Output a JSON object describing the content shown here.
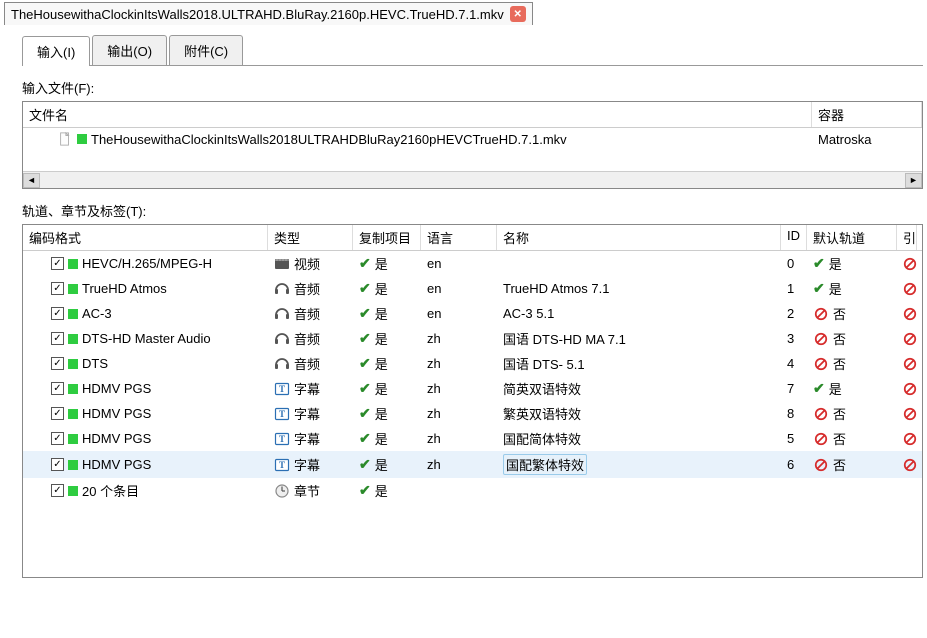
{
  "fileTab": {
    "label": "TheHousewithaClockinItsWalls2018.ULTRAHD.BluRay.2160p.HEVC.TrueHD.7.1.mkv"
  },
  "mainTabs": {
    "input": "输入(I)",
    "output": "输出(O)",
    "attachments": "附件(C)"
  },
  "labels": {
    "inputFiles": "输入文件(F):",
    "tracksChapters": "轨道、章节及标签(T):"
  },
  "filesHeader": {
    "name": "文件名",
    "container": "容器"
  },
  "files": [
    {
      "name": "TheHousewithaClockinItsWalls2018ULTRAHDBluRay2160pHEVCTrueHD.7.1.mkv",
      "container": "Matroska"
    }
  ],
  "tracksHeader": {
    "codec": "编码格式",
    "type": "类型",
    "copy": "复制项目",
    "lang": "语言",
    "name": "名称",
    "id": "ID",
    "default": "默认轨道",
    "last": "引"
  },
  "typeLabels": {
    "video": "视频",
    "audio": "音频",
    "subtitle": "字幕",
    "chapter": "章节"
  },
  "yesNo": {
    "yes": "是",
    "no": "否"
  },
  "tracks": [
    {
      "codec": "HEVC/H.265/MPEG-H",
      "type": "video",
      "copy": true,
      "lang": "en",
      "name": "",
      "id": "0",
      "def": "yes",
      "selected": false
    },
    {
      "codec": "TrueHD Atmos",
      "type": "audio",
      "copy": true,
      "lang": "en",
      "name": "TrueHD Atmos 7.1",
      "id": "1",
      "def": "yes",
      "selected": false
    },
    {
      "codec": "AC-3",
      "type": "audio",
      "copy": true,
      "lang": "en",
      "name": "AC-3 5.1",
      "id": "2",
      "def": "no",
      "selected": false
    },
    {
      "codec": "DTS-HD Master Audio",
      "type": "audio",
      "copy": true,
      "lang": "zh",
      "name": "国语 DTS-HD MA 7.1",
      "id": "3",
      "def": "no",
      "selected": false
    },
    {
      "codec": "DTS",
      "type": "audio",
      "copy": true,
      "lang": "zh",
      "name": "国语 DTS- 5.1",
      "id": "4",
      "def": "no",
      "selected": false
    },
    {
      "codec": "HDMV PGS",
      "type": "subtitle",
      "copy": true,
      "lang": "zh",
      "name": "简英双语特效",
      "id": "7",
      "def": "yes",
      "selected": false
    },
    {
      "codec": "HDMV PGS",
      "type": "subtitle",
      "copy": true,
      "lang": "zh",
      "name": "繁英双语特效",
      "id": "8",
      "def": "no",
      "selected": false
    },
    {
      "codec": "HDMV PGS",
      "type": "subtitle",
      "copy": true,
      "lang": "zh",
      "name": "国配简体特效",
      "id": "5",
      "def": "no",
      "selected": false
    },
    {
      "codec": "HDMV PGS",
      "type": "subtitle",
      "copy": true,
      "lang": "zh",
      "name": "国配繁体特效",
      "id": "6",
      "def": "no",
      "selected": true
    },
    {
      "codec": "20 个条目",
      "type": "chapter",
      "copy": true,
      "lang": "",
      "name": "",
      "id": "",
      "def": "",
      "selected": false
    }
  ]
}
